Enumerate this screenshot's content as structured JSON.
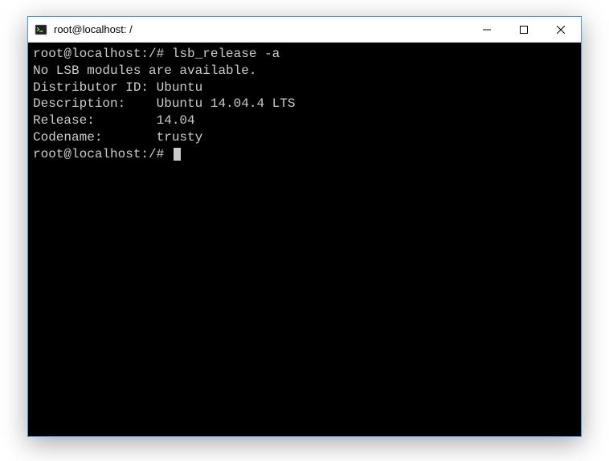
{
  "window": {
    "title": "root@localhost: /"
  },
  "icons": {
    "app": "terminal-icon",
    "minimize": "minimize-icon",
    "maximize": "maximize-icon",
    "close": "close-icon"
  },
  "terminal": {
    "lines": [
      "root@localhost:/# lsb_release -a",
      "No LSB modules are available.",
      "Distributor ID: Ubuntu",
      "Description:    Ubuntu 14.04.4 LTS",
      "Release:        14.04",
      "Codename:       trusty",
      "root@localhost:/# "
    ],
    "prompt": "root@localhost:/#",
    "last_command": "lsb_release -a",
    "output": {
      "lsb_modules": "No LSB modules are available.",
      "distributor_id": "Ubuntu",
      "description": "Ubuntu 14.04.4 LTS",
      "release": "14.04",
      "codename": "trusty"
    }
  },
  "colors": {
    "window_border": "#4a90d9",
    "terminal_bg": "#000000",
    "terminal_fg": "#cccccc",
    "titlebar_bg": "#ffffff",
    "title_text": "#000000"
  }
}
